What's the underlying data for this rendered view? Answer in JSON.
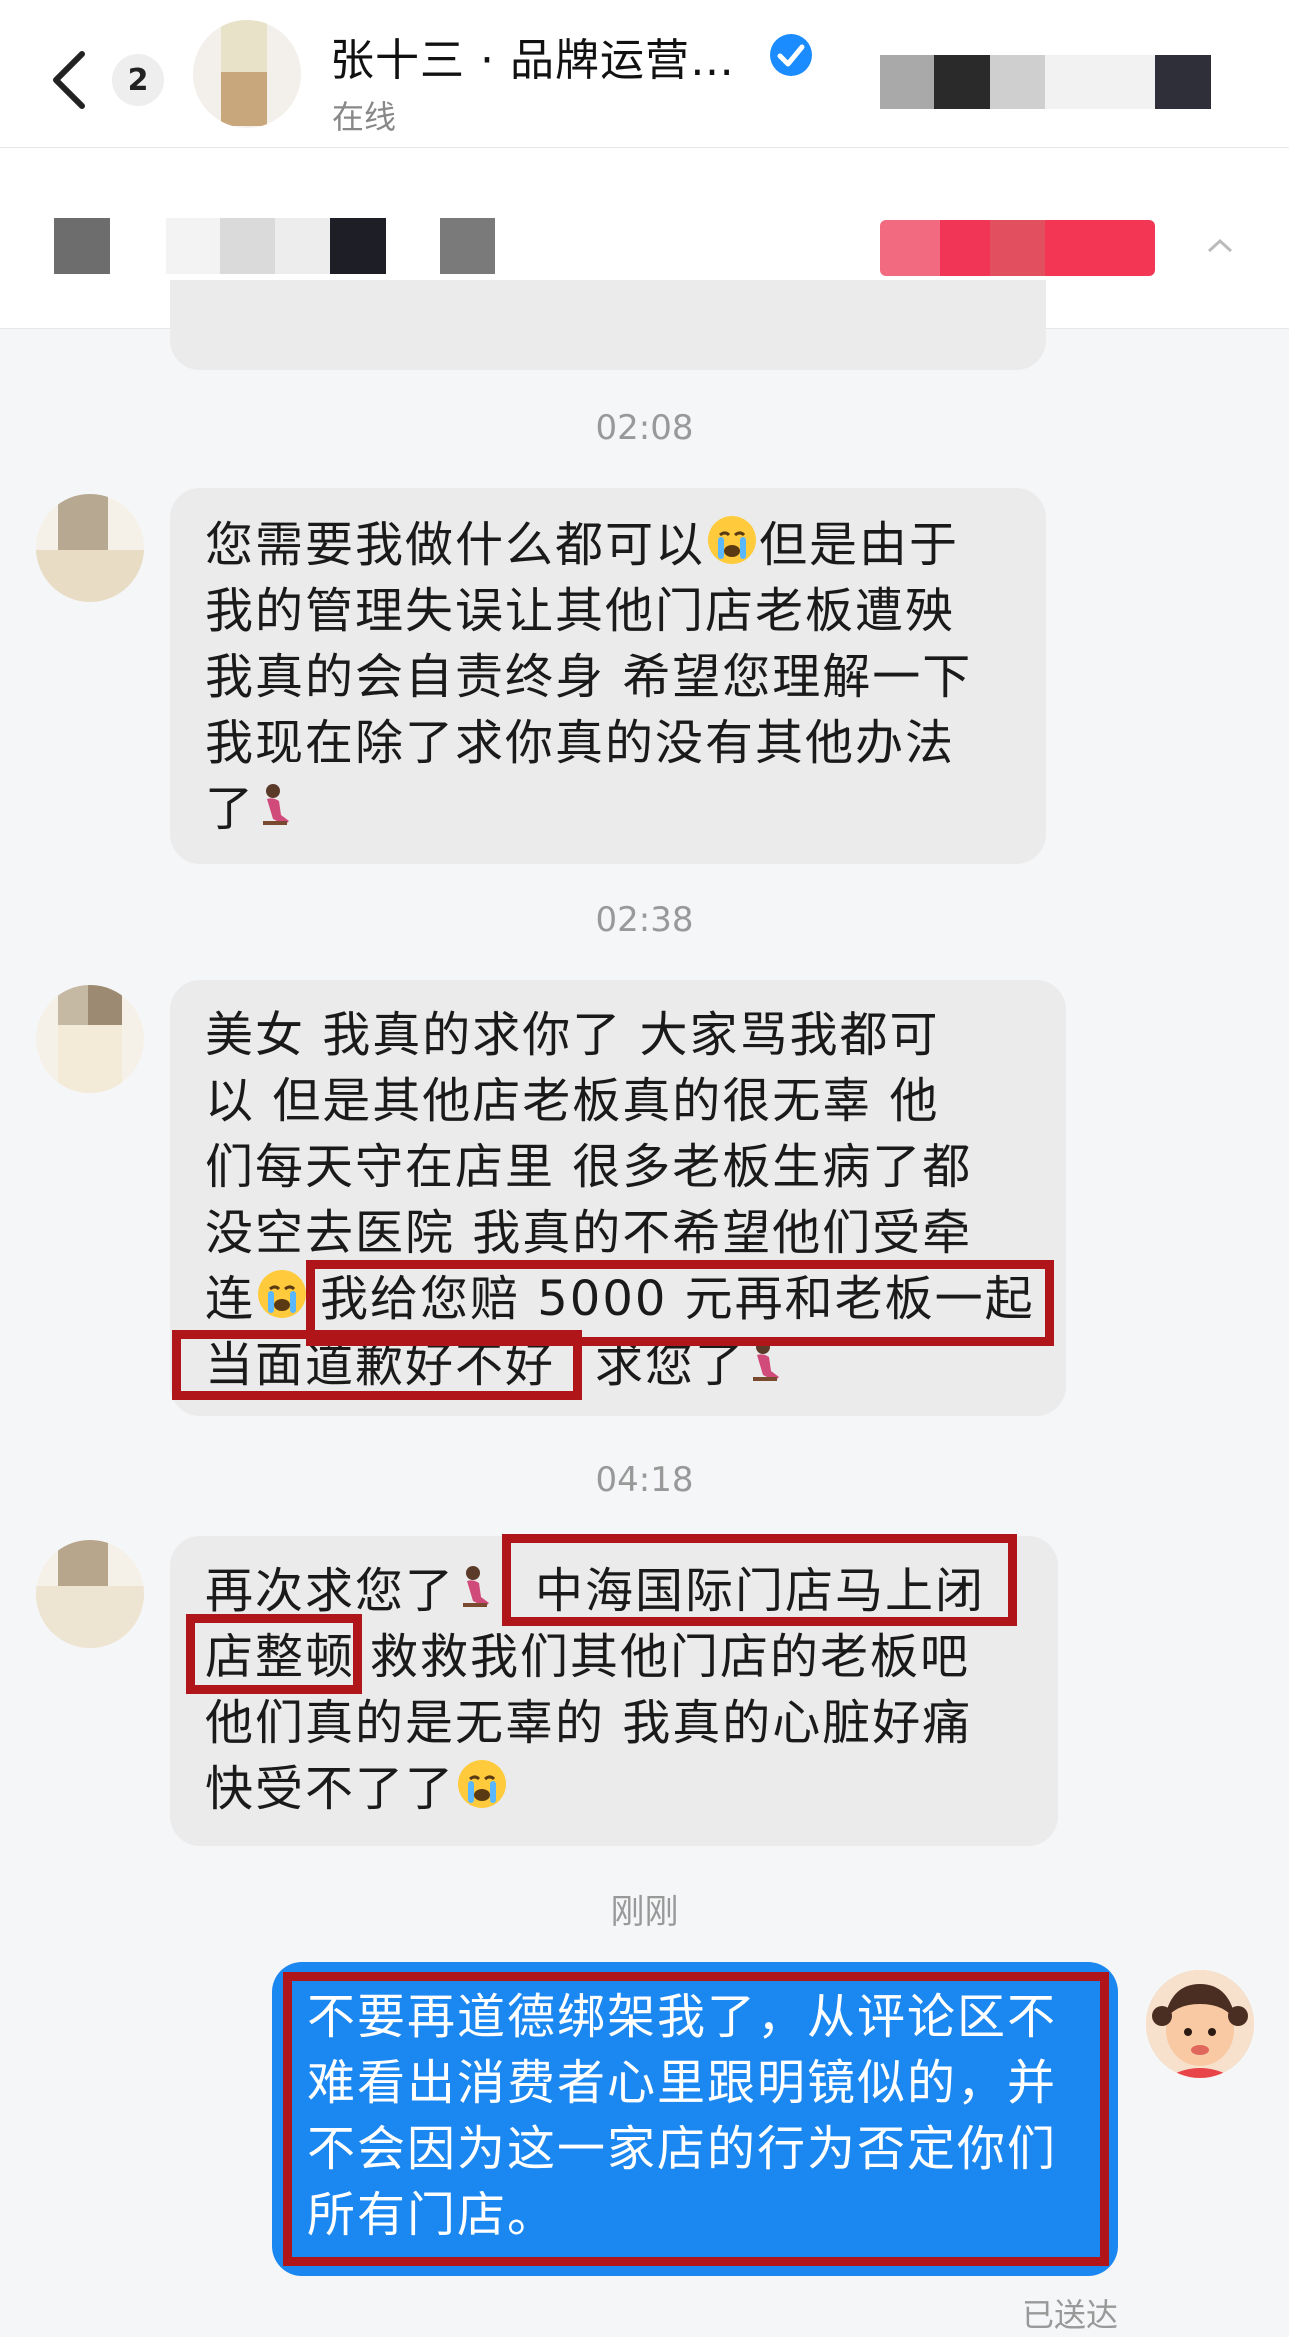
{
  "header": {
    "unread_count": "2",
    "title": "张十三 · 品牌运营…",
    "status": "在线"
  },
  "messages": [
    {
      "time": "02:08",
      "lines": [
        "您需要我做什么都可以",
        "但是由于",
        "我的管理失误让其他门店老板遭殃",
        "我真的会自责终身 希望您理解一下",
        "我现在除了求你真的没有其他办法",
        "了"
      ]
    },
    {
      "time": "02:38",
      "lines": [
        "美女  我真的求你了  大家骂我都可",
        "以  但是其他店老板真的很无辜  他",
        "们每天守在店里  很多老板生病了都",
        "没空去医院 我真的不希望他们受牵",
        "连",
        "我给您赔 5000 元再和老板一起",
        "当面道歉好不好",
        "  求您了"
      ]
    },
    {
      "time": "04:18",
      "lines": [
        "再次求您了",
        "中海国际门店马上闭",
        "店整顿",
        "  救救我们其他门店的老板吧",
        "他们真的是无辜的 我真的心脏好痛",
        "快受不了了"
      ]
    }
  ],
  "reply": {
    "time": "刚刚",
    "lines": [
      "不要再道德绑架我了，从评论区不",
      "难看出消费者心里跟明镜似的，并",
      "不会因为这一家店的行为否定你们",
      "所有门店。"
    ],
    "status": "已送达"
  },
  "colors": {
    "sent_bubble": "#1b87f0",
    "received_bubble": "#ebebeb",
    "highlight_box": "#b0151a",
    "verified_badge": "#1a8cff"
  }
}
